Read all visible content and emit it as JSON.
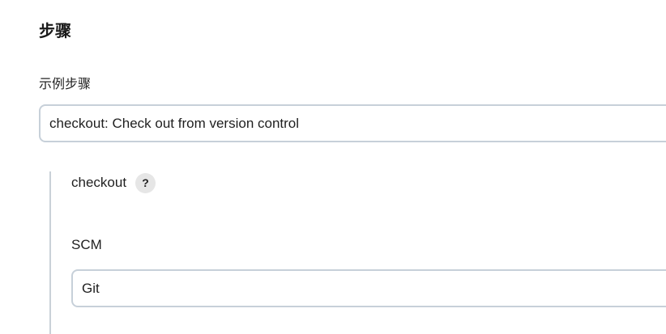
{
  "section": {
    "title": "步骤"
  },
  "sample_step": {
    "label": "示例步骤",
    "selected_value": "checkout: Check out from version control"
  },
  "checkout": {
    "label": "checkout",
    "help_glyph": "?",
    "help_icon": "question-mark-icon"
  },
  "scm": {
    "label": "SCM",
    "selected_value": "Git"
  },
  "colors": {
    "border": "#c7d0d9",
    "help_bg": "#e6e6e6",
    "nested_bar": "#c9d1d8"
  }
}
